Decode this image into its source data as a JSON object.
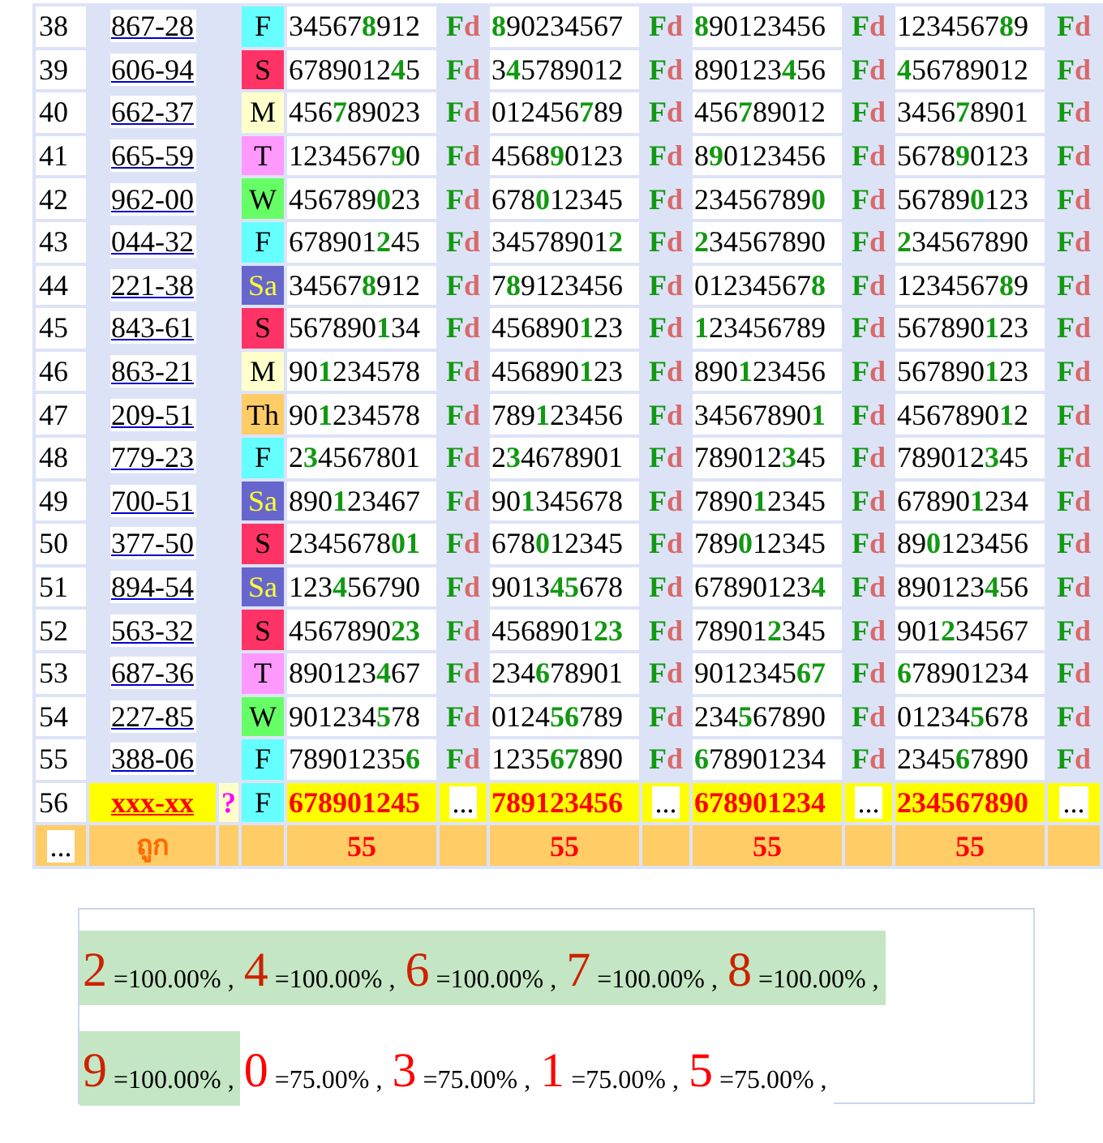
{
  "table": {
    "rows": [
      {
        "no": "38",
        "code": "867-28",
        "day": "F",
        "color": "#66ffff",
        "nums": [
          "34567**8**912",
          "**8**90234567",
          "**8**90123456",
          "1234567**8**9"
        ],
        "fd": [
          "**F**d",
          "**F**d",
          "**F**d",
          "**F**d"
        ]
      },
      {
        "no": "39",
        "code": "606-94",
        "day": "S",
        "color": "#ff3366",
        "nums": [
          "6789012**4**5",
          "3**4**5789012",
          "890123**4**56",
          "**4**56789012"
        ],
        "fd": [
          "**F**d",
          "**F**d",
          "**F**d",
          "**F**d"
        ]
      },
      {
        "no": "40",
        "code": "662-37",
        "day": "M",
        "color": "#ffffcc",
        "nums": [
          "456**7**89023",
          "012456**7**89",
          "456**7**89012",
          "3456**7**8901"
        ],
        "fd": [
          "**F**d",
          "**F**d",
          "**F**d",
          "**F**d"
        ]
      },
      {
        "no": "41",
        "code": "665-59",
        "day": "T",
        "color": "#ff99ff",
        "nums": [
          "1234567**9**0",
          "4568**9**0123",
          "8**9**0123456",
          "5678**9**0123"
        ],
        "fd": [
          "**F**d",
          "**F**d",
          "**F**d",
          "**F**d"
        ]
      },
      {
        "no": "42",
        "code": "962-00",
        "day": "W",
        "color": "#66ff66",
        "nums": [
          "456789**0**23",
          "678**0**12345",
          "23456789**0**",
          "56789**0**123"
        ],
        "fd": [
          "**F**d",
          "**F**d",
          "**F**d",
          "**F**d"
        ]
      },
      {
        "no": "43",
        "code": "044-32",
        "day": "F",
        "color": "#66ffff",
        "nums": [
          "678901**2**45",
          "34578901**2**",
          "**2**34567890",
          "**2**34567890"
        ],
        "fd": [
          "**F**d",
          "**F**d",
          "**F**d",
          "**F**d"
        ]
      },
      {
        "no": "44",
        "code": "221-38",
        "day": "Sa",
        "color": "#6666cc",
        "nums": [
          "34567**8**912",
          "7**8**9123456",
          "01234567**8**",
          "1234567**8**9"
        ],
        "fd": [
          "**F**d",
          "**F**d",
          "**F**d",
          "**F**d"
        ]
      },
      {
        "no": "45",
        "code": "843-61",
        "day": "S",
        "color": "#ff3366",
        "nums": [
          "567890**1**34",
          "456890**1**23",
          "**1**23456789",
          "567890**1**23"
        ],
        "fd": [
          "**F**d",
          "**F**d",
          "**F**d",
          "**F**d"
        ]
      },
      {
        "no": "46",
        "code": "863-21",
        "day": "M",
        "color": "#ffffcc",
        "nums": [
          "90**1**234578",
          "456890**1**23",
          "890**1**23456",
          "567890**1**23"
        ],
        "fd": [
          "**F**d",
          "**F**d",
          "**F**d",
          "**F**d"
        ]
      },
      {
        "no": "47",
        "code": "209-51",
        "day": "Th",
        "color": "#ffcc66",
        "nums": [
          "90**1**234578",
          "789**1**23456",
          "34567890**1**",
          "4567890**1**2"
        ],
        "fd": [
          "**F**d",
          "**F**d",
          "**F**d",
          "**F**d"
        ]
      },
      {
        "no": "48",
        "code": "779-23",
        "day": "F",
        "color": "#66ffff",
        "nums": [
          "2**3**4567801",
          "2**3**4678901",
          "789012**3**45",
          "789012**3**45"
        ],
        "fd": [
          "**F**d",
          "**F**d",
          "**F**d",
          "**F**d"
        ]
      },
      {
        "no": "49",
        "code": "700-51",
        "day": "Sa",
        "color": "#6666cc",
        "nums": [
          "890**1**23467",
          "90**1**345678",
          "7890**1**2345",
          "67890**1**234"
        ],
        "fd": [
          "**F**d",
          "**F**d",
          "**F**d",
          "**F**d"
        ]
      },
      {
        "no": "50",
        "code": "377-50",
        "day": "S",
        "color": "#ff3366",
        "nums": [
          "2345678**01**",
          "678**0**12345",
          "789**0**12345",
          "89**0**123456"
        ],
        "fd": [
          "**F**d",
          "**F**d",
          "**F**d",
          "**F**d"
        ]
      },
      {
        "no": "51",
        "code": "894-54",
        "day": "Sa",
        "color": "#6666cc",
        "nums": [
          "123**4**56790",
          "9013**45**678",
          "67890123**4**",
          "890123**4**56"
        ],
        "fd": [
          "**F**d",
          "**F**d",
          "**F**d",
          "**F**d"
        ]
      },
      {
        "no": "52",
        "code": "563-32",
        "day": "S",
        "color": "#ff3366",
        "nums": [
          "4567890**23**",
          "4568901**23**",
          "78901**2**345",
          "901**2**34567"
        ],
        "fd": [
          "**F**d",
          "**F**d",
          "**F**d",
          "**F**d"
        ]
      },
      {
        "no": "53",
        "code": "687-36",
        "day": "T",
        "color": "#ff99ff",
        "nums": [
          "890123**4**67",
          "234**6**78901",
          "9012345**67**",
          "**6**78901234"
        ],
        "fd": [
          "**F**d",
          "**F**d",
          "**F**d",
          "**F**d"
        ]
      },
      {
        "no": "54",
        "code": "227-85",
        "day": "W",
        "color": "#66ff66",
        "nums": [
          "901234**5**78",
          "0124**56**789",
          "234**5**67890",
          "01234**5**678"
        ],
        "fd": [
          "**F**d",
          "**F**d",
          "**F**d",
          "**F**d"
        ]
      },
      {
        "no": "55",
        "code": "388-06",
        "day": "F",
        "color": "#66ffff",
        "nums": [
          "78901235**6**",
          "1235**67**890",
          "**6**78901234",
          "2345**6**7890"
        ],
        "fd": [
          "**F**d",
          "**F**d",
          "**F**d",
          "**F**d"
        ]
      }
    ],
    "current": {
      "no": "56",
      "code": "xxx-xx",
      "mark": "?",
      "day": "F",
      "color": "#66ffff",
      "nums": [
        "678901245",
        "789123456",
        "678901234",
        "234567890"
      ],
      "more": [
        "...",
        "...",
        "...",
        "..."
      ]
    },
    "footer": {
      "more": "...",
      "label": "ถูก",
      "counts": [
        "55",
        "55",
        "55",
        "55"
      ]
    }
  },
  "stats": [
    {
      "digit": "2",
      "pct": "=100.00%",
      "sep": ",",
      "highlight": true
    },
    {
      "digit": "4",
      "pct": "=100.00%",
      "sep": ",",
      "highlight": true
    },
    {
      "digit": "6",
      "pct": "=100.00%",
      "sep": ",",
      "highlight": true
    },
    {
      "digit": "7",
      "pct": "=100.00%",
      "sep": ",",
      "highlight": true
    },
    {
      "digit": "8",
      "pct": "=100.00%",
      "sep": ",",
      "highlight": true
    },
    {
      "digit": "9",
      "pct": "=100.00%",
      "sep": ",",
      "highlight": true
    },
    {
      "digit": "0",
      "pct": "=75.00%",
      "sep": ",",
      "highlight": false
    },
    {
      "digit": "3",
      "pct": "=75.00%",
      "sep": ",",
      "highlight": false
    },
    {
      "digit": "1",
      "pct": "=75.00%",
      "sep": ",",
      "highlight": false
    },
    {
      "digit": "5",
      "pct": "=75.00%",
      "sep": ",",
      "highlight": false
    }
  ]
}
